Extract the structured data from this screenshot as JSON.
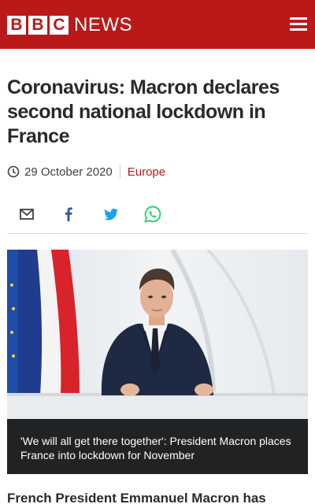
{
  "header": {
    "logo_letters": [
      "B",
      "B",
      "C"
    ],
    "logo_word": "NEWS",
    "brand_color": "#bb1919",
    "menu_icon": "hamburger-menu-icon"
  },
  "article": {
    "headline": "Coronavirus: Macron declares second national lockdown in France",
    "date": "29 October 2020",
    "topic": "Europe",
    "lead_visible": "French President Emmanuel Macron has"
  },
  "share": {
    "icons": [
      "email-icon",
      "facebook-icon",
      "twitter-icon",
      "whatsapp-icon"
    ]
  },
  "image": {
    "caption": "'We will all get there together': President Macron places France into lockdown for November"
  }
}
